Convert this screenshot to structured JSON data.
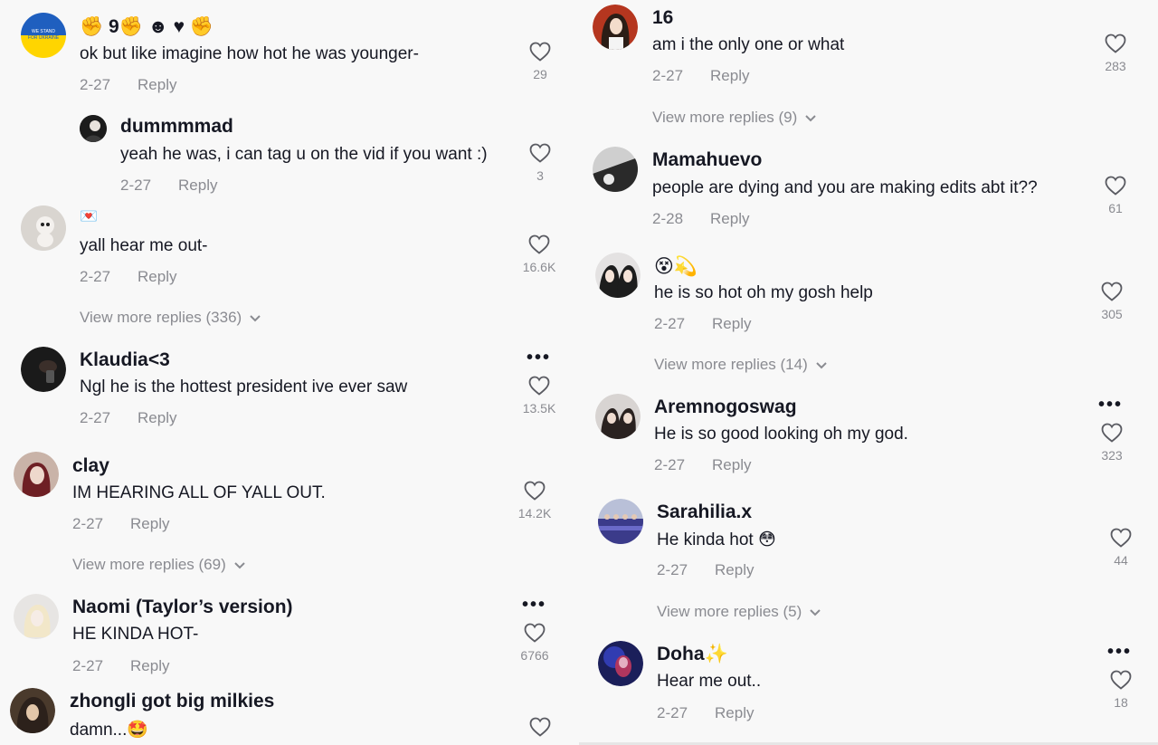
{
  "left": {
    "c1": {
      "username": "✊ 9✊ ☻ ♥ ✊",
      "text": "ok but like imagine how hot he was younger-",
      "date": "2-27",
      "reply": "Reply",
      "likes": "29"
    },
    "c1r": {
      "username": "dummmmad",
      "text": "yeah he was, i can tag u on the vid if you want :)",
      "date": "2-27",
      "reply": "Reply",
      "likes": "3"
    },
    "c2": {
      "username": "💌",
      "text": "yall hear me out-",
      "date": "2-27",
      "reply": "Reply",
      "likes": "16.6K",
      "more": "View more replies (336)"
    },
    "c3": {
      "username": "Klaudia<3",
      "text": "Ngl he is the hottest president ive ever saw",
      "date": "2-27",
      "reply": "Reply",
      "likes": "13.5K"
    },
    "c4": {
      "username": "clay",
      "text": "IM HEARING ALL OF YALL OUT.",
      "date": "2-27",
      "reply": "Reply",
      "likes": "14.2K",
      "more": "View more replies (69)"
    },
    "c5": {
      "username": "Naomi (Taylor’s version)",
      "text": "HE KINDA HOT-",
      "date": "2-27",
      "reply": "Reply",
      "likes": "6766"
    },
    "c6": {
      "username": "zhongli got big milkies",
      "text": "damn...🤩"
    }
  },
  "right": {
    "c1": {
      "username": "16",
      "text": "am i the only one or what",
      "date": "2-27",
      "reply": "Reply",
      "likes": "283",
      "more": "View more replies (9)"
    },
    "c2": {
      "username": "Mamahuevo",
      "text": "people are dying and you are making edits abt it??",
      "date": "2-28",
      "reply": "Reply",
      "likes": "61"
    },
    "c3": {
      "username": "😵💫",
      "text": "he is so hot oh my gosh help",
      "date": "2-27",
      "reply": "Reply",
      "likes": "305",
      "more": "View more replies (14)"
    },
    "c4": {
      "username": "Aremnogoswag",
      "text": "He is so good looking oh my god.",
      "date": "2-27",
      "reply": "Reply",
      "likes": "323"
    },
    "c5": {
      "username": "Sarahilia.x",
      "text": "He kinda hot 😳",
      "date": "2-27",
      "reply": "Reply",
      "likes": "44",
      "more": "View more replies (5)"
    },
    "c6": {
      "username": "Doha✨",
      "text": "Hear me out..",
      "date": "2-27",
      "reply": "Reply",
      "likes": "18"
    }
  },
  "icons": {
    "heart": "heart-outline-icon",
    "more": "more-dots-icon",
    "chevron": "chevron-down-icon"
  },
  "colors": {
    "text": "#161823",
    "secondary": "#8a8b91",
    "background": "#f8f8f8"
  }
}
